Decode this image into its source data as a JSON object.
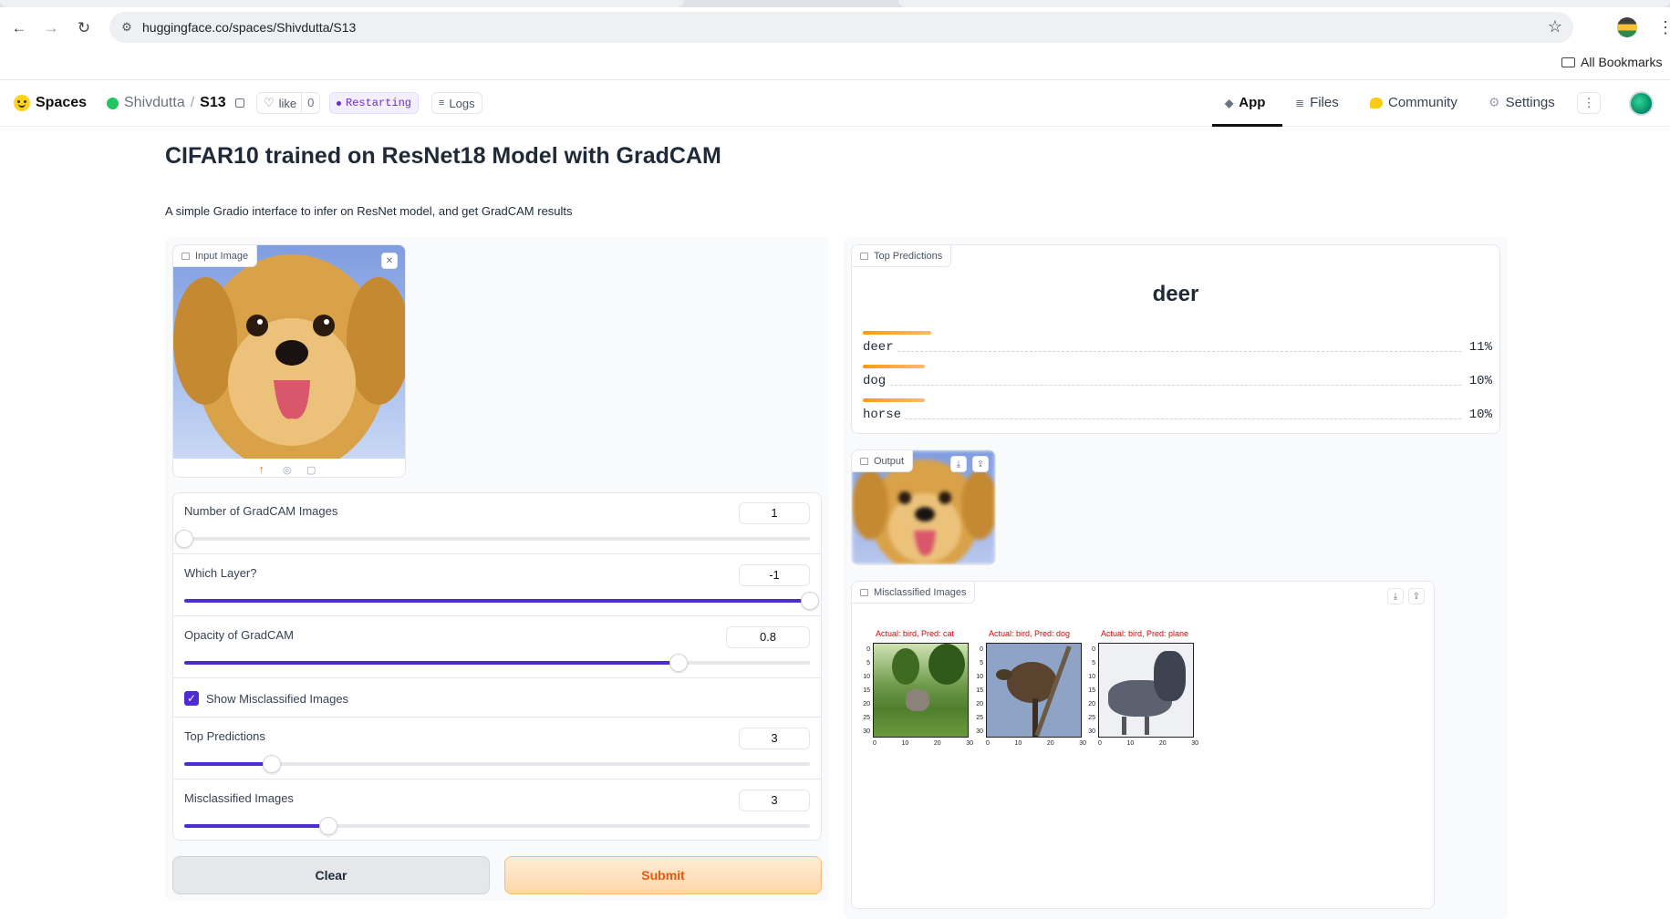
{
  "browser": {
    "url": "huggingface.co/spaces/Shivdutta/S13",
    "bookmarks_label": "All Bookmarks"
  },
  "header": {
    "spaces_label": "Spaces",
    "owner": "Shivdutta",
    "repo": "S13",
    "like_label": "like",
    "like_count": "0",
    "status": "Restarting",
    "logs_label": "Logs",
    "tabs": [
      {
        "label": "App",
        "icon": "cube-icon"
      },
      {
        "label": "Files",
        "icon": "files-icon"
      },
      {
        "label": "Community",
        "icon": "community-icon"
      },
      {
        "label": "Settings",
        "icon": "gear-icon"
      }
    ]
  },
  "page": {
    "title": "CIFAR10 trained on ResNet18 Model with GradCAM",
    "description": "A simple Gradio interface to infer on ResNet model, and get GradCAM results"
  },
  "input_image": {
    "label": "Input Image"
  },
  "controls": {
    "gradcam_count": {
      "label": "Number of GradCAM Images",
      "value": "1",
      "fraction": 0.0
    },
    "layer": {
      "label": "Which Layer?",
      "value": "-1",
      "fraction": 1.0
    },
    "opacity": {
      "label": "Opacity of GradCAM",
      "value": "0.8",
      "fraction": 0.79
    },
    "show_misclassified": {
      "label": "Show Misclassified Images",
      "checked": true
    },
    "top_predictions": {
      "label": "Top Predictions",
      "value": "3",
      "fraction": 0.14
    },
    "misclassified_images": {
      "label": "Misclassified Images",
      "value": "3",
      "fraction": 0.23
    }
  },
  "buttons": {
    "clear": "Clear",
    "submit": "Submit"
  },
  "top_predictions": {
    "label": "Top Predictions",
    "top_label": "deer",
    "rows": [
      {
        "name": "deer",
        "value": "11%",
        "fraction": 0.11
      },
      {
        "name": "dog",
        "value": "10%",
        "fraction": 0.1
      },
      {
        "name": "horse",
        "value": "10%",
        "fraction": 0.1
      }
    ]
  },
  "output": {
    "label": "Output"
  },
  "misclassified": {
    "label": "Misclassified Images",
    "items": [
      {
        "title": "Actual: bird, Pred: cat"
      },
      {
        "title": "Actual: bird, Pred: dog"
      },
      {
        "title": "Actual: bird, Pred: plane"
      }
    ],
    "y_ticks": [
      "0",
      "5",
      "10",
      "15",
      "20",
      "25",
      "30"
    ],
    "x_ticks": [
      "0",
      "10",
      "20",
      "30"
    ]
  },
  "colors": {
    "accent": "#4f2bd6",
    "submit_bg": "#fed7aa",
    "submit_text": "#ea580c",
    "status": "#6d28d9"
  }
}
